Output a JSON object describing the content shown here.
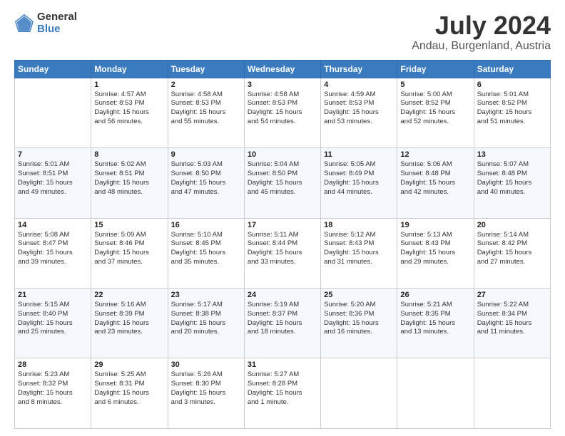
{
  "logo": {
    "general": "General",
    "blue": "Blue"
  },
  "title": {
    "month_year": "July 2024",
    "location": "Andau, Burgenland, Austria"
  },
  "weekdays": [
    "Sunday",
    "Monday",
    "Tuesday",
    "Wednesday",
    "Thursday",
    "Friday",
    "Saturday"
  ],
  "weeks": [
    [
      {
        "day": "",
        "info": ""
      },
      {
        "day": "1",
        "info": "Sunrise: 4:57 AM\nSunset: 8:53 PM\nDaylight: 15 hours\nand 56 minutes."
      },
      {
        "day": "2",
        "info": "Sunrise: 4:58 AM\nSunset: 8:53 PM\nDaylight: 15 hours\nand 55 minutes."
      },
      {
        "day": "3",
        "info": "Sunrise: 4:58 AM\nSunset: 8:53 PM\nDaylight: 15 hours\nand 54 minutes."
      },
      {
        "day": "4",
        "info": "Sunrise: 4:59 AM\nSunset: 8:53 PM\nDaylight: 15 hours\nand 53 minutes."
      },
      {
        "day": "5",
        "info": "Sunrise: 5:00 AM\nSunset: 8:52 PM\nDaylight: 15 hours\nand 52 minutes."
      },
      {
        "day": "6",
        "info": "Sunrise: 5:01 AM\nSunset: 8:52 PM\nDaylight: 15 hours\nand 51 minutes."
      }
    ],
    [
      {
        "day": "7",
        "info": "Sunrise: 5:01 AM\nSunset: 8:51 PM\nDaylight: 15 hours\nand 49 minutes."
      },
      {
        "day": "8",
        "info": "Sunrise: 5:02 AM\nSunset: 8:51 PM\nDaylight: 15 hours\nand 48 minutes."
      },
      {
        "day": "9",
        "info": "Sunrise: 5:03 AM\nSunset: 8:50 PM\nDaylight: 15 hours\nand 47 minutes."
      },
      {
        "day": "10",
        "info": "Sunrise: 5:04 AM\nSunset: 8:50 PM\nDaylight: 15 hours\nand 45 minutes."
      },
      {
        "day": "11",
        "info": "Sunrise: 5:05 AM\nSunset: 8:49 PM\nDaylight: 15 hours\nand 44 minutes."
      },
      {
        "day": "12",
        "info": "Sunrise: 5:06 AM\nSunset: 8:48 PM\nDaylight: 15 hours\nand 42 minutes."
      },
      {
        "day": "13",
        "info": "Sunrise: 5:07 AM\nSunset: 8:48 PM\nDaylight: 15 hours\nand 40 minutes."
      }
    ],
    [
      {
        "day": "14",
        "info": "Sunrise: 5:08 AM\nSunset: 8:47 PM\nDaylight: 15 hours\nand 39 minutes."
      },
      {
        "day": "15",
        "info": "Sunrise: 5:09 AM\nSunset: 8:46 PM\nDaylight: 15 hours\nand 37 minutes."
      },
      {
        "day": "16",
        "info": "Sunrise: 5:10 AM\nSunset: 8:45 PM\nDaylight: 15 hours\nand 35 minutes."
      },
      {
        "day": "17",
        "info": "Sunrise: 5:11 AM\nSunset: 8:44 PM\nDaylight: 15 hours\nand 33 minutes."
      },
      {
        "day": "18",
        "info": "Sunrise: 5:12 AM\nSunset: 8:43 PM\nDaylight: 15 hours\nand 31 minutes."
      },
      {
        "day": "19",
        "info": "Sunrise: 5:13 AM\nSunset: 8:43 PM\nDaylight: 15 hours\nand 29 minutes."
      },
      {
        "day": "20",
        "info": "Sunrise: 5:14 AM\nSunset: 8:42 PM\nDaylight: 15 hours\nand 27 minutes."
      }
    ],
    [
      {
        "day": "21",
        "info": "Sunrise: 5:15 AM\nSunset: 8:40 PM\nDaylight: 15 hours\nand 25 minutes."
      },
      {
        "day": "22",
        "info": "Sunrise: 5:16 AM\nSunset: 8:39 PM\nDaylight: 15 hours\nand 23 minutes."
      },
      {
        "day": "23",
        "info": "Sunrise: 5:17 AM\nSunset: 8:38 PM\nDaylight: 15 hours\nand 20 minutes."
      },
      {
        "day": "24",
        "info": "Sunrise: 5:19 AM\nSunset: 8:37 PM\nDaylight: 15 hours\nand 18 minutes."
      },
      {
        "day": "25",
        "info": "Sunrise: 5:20 AM\nSunset: 8:36 PM\nDaylight: 15 hours\nand 16 minutes."
      },
      {
        "day": "26",
        "info": "Sunrise: 5:21 AM\nSunset: 8:35 PM\nDaylight: 15 hours\nand 13 minutes."
      },
      {
        "day": "27",
        "info": "Sunrise: 5:22 AM\nSunset: 8:34 PM\nDaylight: 15 hours\nand 11 minutes."
      }
    ],
    [
      {
        "day": "28",
        "info": "Sunrise: 5:23 AM\nSunset: 8:32 PM\nDaylight: 15 hours\nand 8 minutes."
      },
      {
        "day": "29",
        "info": "Sunrise: 5:25 AM\nSunset: 8:31 PM\nDaylight: 15 hours\nand 6 minutes."
      },
      {
        "day": "30",
        "info": "Sunrise: 5:26 AM\nSunset: 8:30 PM\nDaylight: 15 hours\nand 3 minutes."
      },
      {
        "day": "31",
        "info": "Sunrise: 5:27 AM\nSunset: 8:28 PM\nDaylight: 15 hours\nand 1 minute."
      },
      {
        "day": "",
        "info": ""
      },
      {
        "day": "",
        "info": ""
      },
      {
        "day": "",
        "info": ""
      }
    ]
  ]
}
